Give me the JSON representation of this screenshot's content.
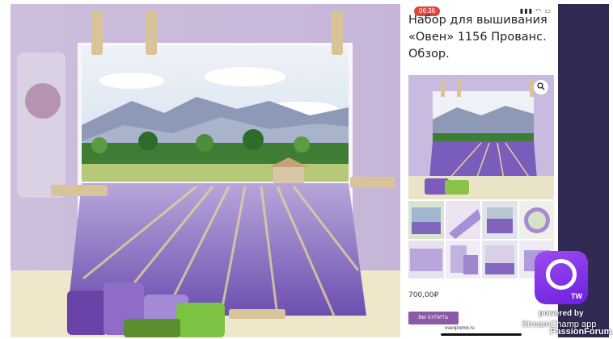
{
  "status_bar": {
    "time": "06:36",
    "icons": "▮▮▮ ◠ ▭"
  },
  "product": {
    "title": "Набор для вышивания «Овен» 1156 Прованс. Обзор.",
    "price": "700,00₽",
    "buy_label": "ВЫ КУПИТЬ",
    "url": "ovenpremir.ru"
  },
  "icons": {
    "zoom": "magnifier-icon",
    "stream_logo": "twitch-style-icon"
  },
  "overlay": {
    "logo_text": "TW",
    "powered_by": "powered by",
    "streamchamp": "StreamChamp app",
    "forum": "PassionForum.ru"
  },
  "colors": {
    "lavender": "#8a6dc4",
    "sky": "#d9e4f3",
    "mountains": "#8e98b7",
    "trees": "#3f7d35",
    "accent_strip": "#302a55",
    "buy_button": "#8a5aa6",
    "logo_gradient": "#8b3ff0"
  }
}
